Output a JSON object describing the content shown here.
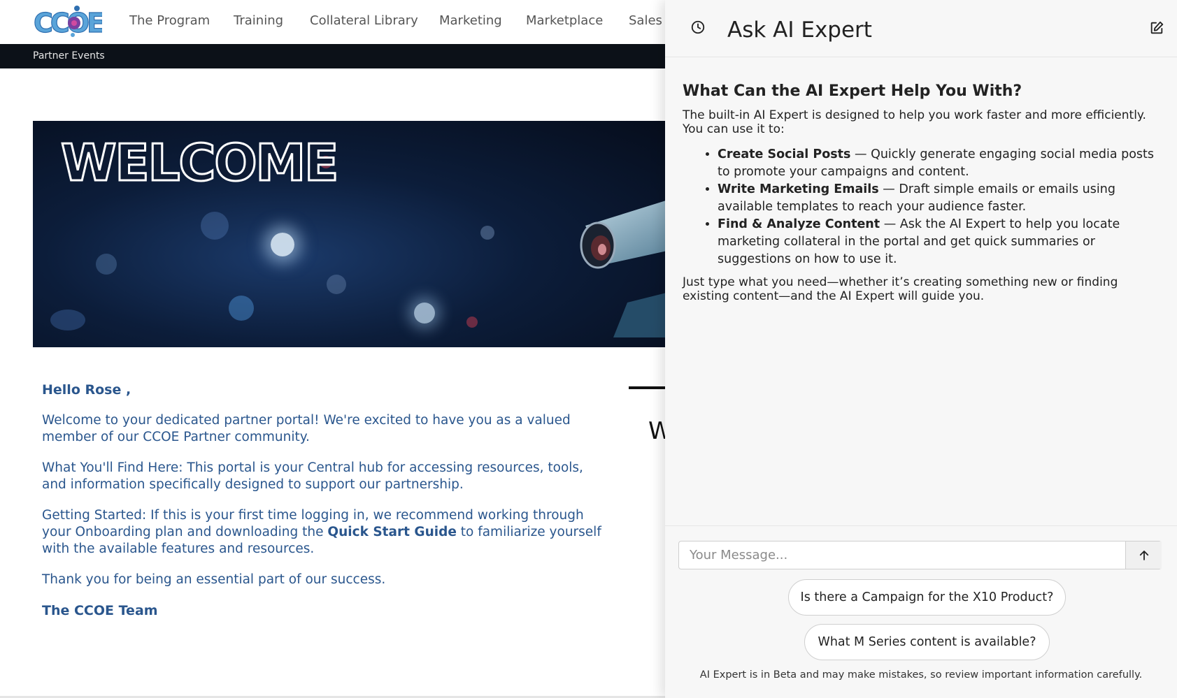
{
  "nav": {
    "logo_text": "CCOE",
    "items": [
      "The Program",
      "Training",
      "Collateral Library",
      "Marketing",
      "Marketplace",
      "Sales"
    ]
  },
  "subnav": {
    "items": [
      "Partner Events"
    ]
  },
  "banner": {
    "headline": "WELCOME"
  },
  "content": {
    "greeting": "Hello Rose ,",
    "p1": "Welcome to your dedicated partner portal! We're excited to have you as a valued member of our CCOE Partner community.",
    "p2": "What You'll Find Here: This portal is your Central hub for accessing resources, tools, and information specifically designed to support our partnership.",
    "p3_before": "Getting Started: If this is your first time logging in, we recommend working through your Onboarding plan and downloading the ",
    "p3_link": "Quick Start Guide",
    "p3_after": " to familiarize yourself with the available features and resources.",
    "p4": "Thank you for being an essential part of our success.",
    "signature": "The CCOE Team"
  },
  "side_card": {
    "letter": "W"
  },
  "ai_panel": {
    "title": "Ask AI Expert",
    "heading": "What Can the AI Expert Help You With?",
    "intro": "The built-in AI Expert is designed to help you work faster and more efficiently. You can use it to:",
    "features": [
      {
        "name": "Create Social Posts",
        "desc": " — Quickly generate engaging social media posts to promote your campaigns and content."
      },
      {
        "name": "Write Marketing Emails",
        "desc": " — Draft simple emails or emails using available templates to reach your audience faster."
      },
      {
        "name": "Find & Analyze Content",
        "desc": " — Ask the AI Expert to help you locate marketing collateral in the portal and get quick summaries or suggestions on how to use it."
      }
    ],
    "outro": "Just type what you need—whether it’s creating something new or finding existing content—and the AI Expert will guide you.",
    "input_placeholder": "Your Message...",
    "suggestions": [
      "Is there a Campaign for the X10 Product?",
      "What M Series content is available?"
    ],
    "disclaimer": "AI Expert is in Beta and may make mistakes, so review important information carefully."
  },
  "colors": {
    "accent_blue": "#2a568d",
    "subnav_bg": "#0c1118",
    "panel_bg": "#f7f7f7"
  }
}
